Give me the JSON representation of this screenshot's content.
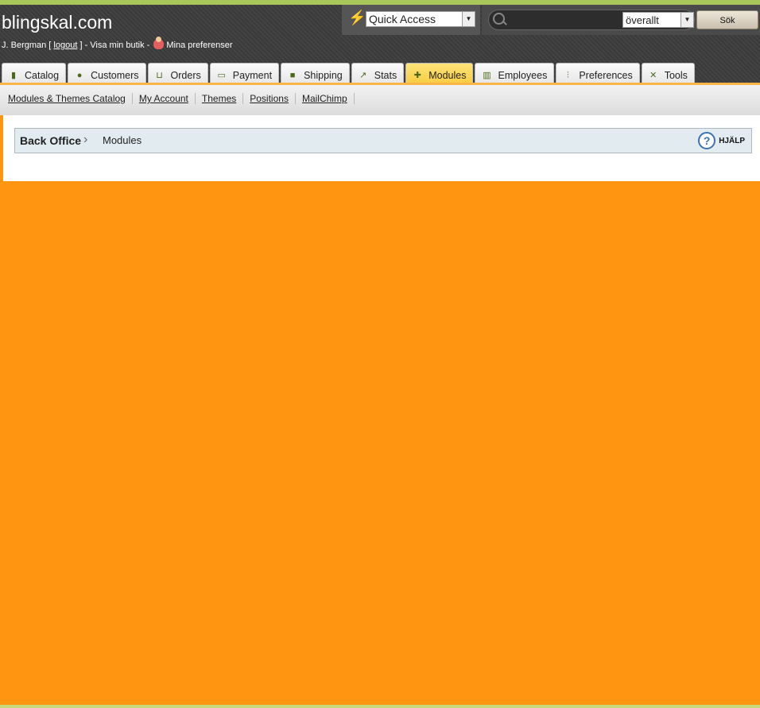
{
  "header": {
    "shop_name": "blingskal.com",
    "user": "J. Bergman",
    "logout": "logout",
    "view_shop": "Visa min butik",
    "preferences": "Mina preferenser"
  },
  "quick_access": {
    "label": "Quick Access"
  },
  "search": {
    "scope": "överallt",
    "button": "Sök",
    "placeholder": ""
  },
  "tabs": [
    {
      "label": "Catalog",
      "icon": "book-icon"
    },
    {
      "label": "Customers",
      "icon": "person-icon"
    },
    {
      "label": "Orders",
      "icon": "cart-icon"
    },
    {
      "label": "Payment",
      "icon": "card-icon"
    },
    {
      "label": "Shipping",
      "icon": "truck-icon"
    },
    {
      "label": "Stats",
      "icon": "chart-icon"
    },
    {
      "label": "Modules",
      "icon": "puzzle-icon",
      "active": true
    },
    {
      "label": "Employees",
      "icon": "employees-icon"
    },
    {
      "label": "Preferences",
      "icon": "sliders-icon"
    },
    {
      "label": "Tools",
      "icon": "tools-icon"
    }
  ],
  "subnav": [
    "Modules & Themes Catalog",
    "My Account",
    "Themes",
    "Positions",
    "MailChimp"
  ],
  "breadcrumb": {
    "root": "Back Office",
    "current": "Modules"
  },
  "help": {
    "label": "HJÄLP"
  },
  "colors": {
    "accent": "#ff9511",
    "active_tab": "#f5c836"
  }
}
